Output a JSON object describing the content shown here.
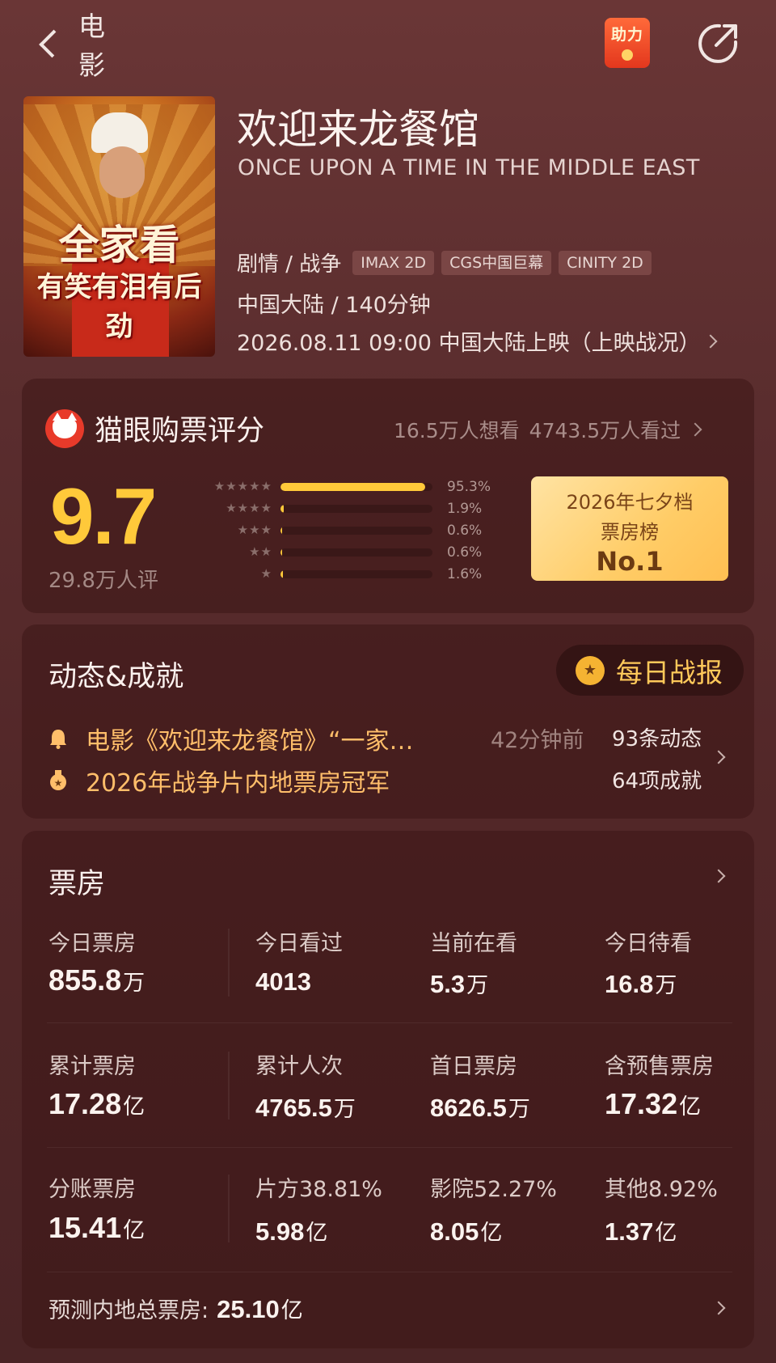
{
  "header": {
    "back_label": "电影",
    "help_badge": "助力"
  },
  "poster": {
    "line1": "全家看",
    "line2": "有笑有泪有后劲"
  },
  "movie": {
    "title": "欢迎来龙餐馆",
    "en_title": "ONCE UPON A TIME IN THE MIDDLE EAST",
    "genre": "剧情 / 战争",
    "tags": [
      "IMAX 2D",
      "CGS中国巨幕",
      "CINITY 2D"
    ],
    "region_duration": "中国大陆 / 140分钟",
    "release": "2026.08.11 09:00 中国大陆上映（上映战况）"
  },
  "rating": {
    "title": "猫眼购票评分",
    "want_see": "16.5万人想看",
    "watched": "4743.5万人看过",
    "score": "9.7",
    "count": "29.8万人评",
    "dist": [
      {
        "stars": "★★★★★",
        "pct_label": "95.3%",
        "pct": 95.3
      },
      {
        "stars": "★★★★",
        "pct_label": "1.9%",
        "pct": 1.9
      },
      {
        "stars": "★★★",
        "pct_label": "0.6%",
        "pct": 0.6
      },
      {
        "stars": "★★",
        "pct_label": "0.6%",
        "pct": 0.6
      },
      {
        "stars": "★",
        "pct_label": "1.6%",
        "pct": 1.6
      }
    ],
    "rank": {
      "line1": "2026年七夕档",
      "line2": "票房榜",
      "line3": "No.1"
    }
  },
  "dynamics": {
    "title": "动态&成就",
    "daily_report": "每日战报",
    "news": "电影《欢迎来龙餐馆》“一家…",
    "news_time": "42分钟前",
    "news_count": "93条动态",
    "achievement": "2026年战争片内地票房冠军",
    "achievement_count": "64项成就"
  },
  "box_office": {
    "title": "票房",
    "rows": [
      [
        {
          "label": "今日票房",
          "value": "855.8",
          "unit": "万"
        },
        {
          "label": "今日看过",
          "value": "4013",
          "unit": ""
        },
        {
          "label": "当前在看",
          "value": "5.3",
          "unit": "万"
        },
        {
          "label": "今日待看",
          "value": "16.8",
          "unit": "万"
        }
      ],
      [
        {
          "label": "累计票房",
          "value": "17.28",
          "unit": "亿"
        },
        {
          "label": "累计人次",
          "value": "4765.5",
          "unit": "万"
        },
        {
          "label": "首日票房",
          "value": "8626.5",
          "unit": "万"
        },
        {
          "label": "含预售票房",
          "value": "17.32",
          "unit": "亿"
        }
      ],
      [
        {
          "label": "分账票房",
          "value": "15.41",
          "unit": "亿"
        },
        {
          "label": "片方38.81%",
          "value": "5.98",
          "unit": "亿"
        },
        {
          "label": "影院52.27%",
          "value": "8.05",
          "unit": "亿"
        },
        {
          "label": "其他8.92%",
          "value": "1.37",
          "unit": "亿"
        }
      ]
    ],
    "forecast_label": "预测内地总票房:",
    "forecast_value": "25.10",
    "forecast_unit": "亿"
  },
  "colors": {
    "accent": "#ffc93a",
    "background": "#5a2a2b",
    "link": "#ffbe6a"
  }
}
